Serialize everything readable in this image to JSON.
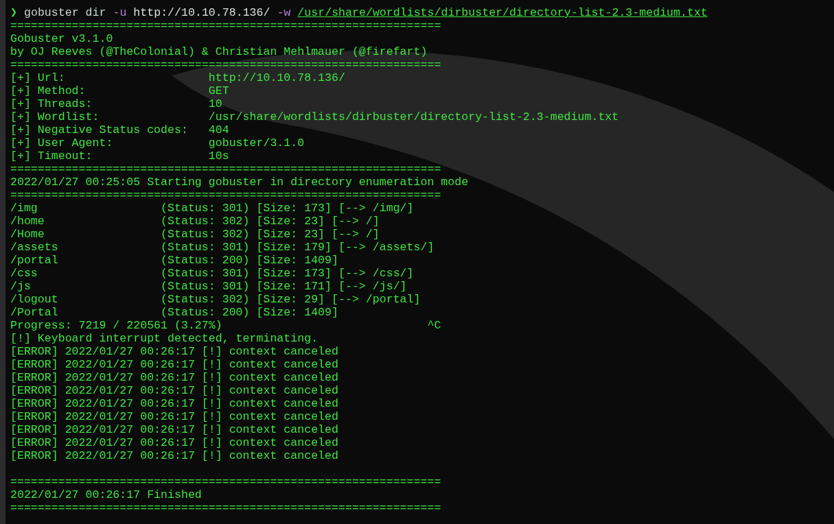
{
  "command_line": {
    "prompt": "❯",
    "segments": [
      {
        "kind": "command",
        "text": "gobuster dir"
      },
      {
        "kind": "flag",
        "text": "-u"
      },
      {
        "kind": "arg",
        "text": "http://10.10.78.136/"
      },
      {
        "kind": "flag",
        "text": "-w"
      },
      {
        "kind": "path",
        "text": "/usr/share/wordlists/dirbuster/directory-list-2.3-medium.txt"
      }
    ]
  },
  "output_lines": [
    {
      "kind": "rule",
      "text": "==============================================================="
    },
    {
      "kind": "text",
      "text": "Gobuster v3.1.0"
    },
    {
      "kind": "text",
      "text": "by OJ Reeves (@TheColonial) & Christian Mehlmauer (@firefart)"
    },
    {
      "kind": "rule",
      "text": "==============================================================="
    },
    {
      "kind": "text",
      "text": "[+] Url:                     http://10.10.78.136/"
    },
    {
      "kind": "text",
      "text": "[+] Method:                  GET"
    },
    {
      "kind": "text",
      "text": "[+] Threads:                 10"
    },
    {
      "kind": "text",
      "text": "[+] Wordlist:                /usr/share/wordlists/dirbuster/directory-list-2.3-medium.txt"
    },
    {
      "kind": "text",
      "text": "[+] Negative Status codes:   404"
    },
    {
      "kind": "text",
      "text": "[+] User Agent:              gobuster/3.1.0"
    },
    {
      "kind": "text",
      "text": "[+] Timeout:                 10s"
    },
    {
      "kind": "rule",
      "text": "==============================================================="
    },
    {
      "kind": "text",
      "text": "2022/01/27 00:25:05 Starting gobuster in directory enumeration mode"
    },
    {
      "kind": "rule",
      "text": "==============================================================="
    },
    {
      "kind": "text",
      "text": "/img                  (Status: 301) [Size: 173] [--> /img/]"
    },
    {
      "kind": "text",
      "text": "/home                 (Status: 302) [Size: 23] [--> /]"
    },
    {
      "kind": "text",
      "text": "/Home                 (Status: 302) [Size: 23] [--> /]"
    },
    {
      "kind": "text",
      "text": "/assets               (Status: 301) [Size: 179] [--> /assets/]"
    },
    {
      "kind": "text",
      "text": "/portal               (Status: 200) [Size: 1409]"
    },
    {
      "kind": "text",
      "text": "/css                  (Status: 301) [Size: 173] [--> /css/]"
    },
    {
      "kind": "text",
      "text": "/js                   (Status: 301) [Size: 171] [--> /js/]"
    },
    {
      "kind": "text",
      "text": "/logout               (Status: 302) [Size: 29] [--> /portal]"
    },
    {
      "kind": "text",
      "text": "/Portal               (Status: 200) [Size: 1409]"
    },
    {
      "kind": "text",
      "text": "Progress: 7219 / 220561 (3.27%)                              ^C"
    },
    {
      "kind": "text",
      "text": "[!] Keyboard interrupt detected, terminating."
    },
    {
      "kind": "text",
      "text": "[ERROR] 2022/01/27 00:26:17 [!] context canceled"
    },
    {
      "kind": "text",
      "text": "[ERROR] 2022/01/27 00:26:17 [!] context canceled"
    },
    {
      "kind": "text",
      "text": "[ERROR] 2022/01/27 00:26:17 [!] context canceled"
    },
    {
      "kind": "text",
      "text": "[ERROR] 2022/01/27 00:26:17 [!] context canceled"
    },
    {
      "kind": "text",
      "text": "[ERROR] 2022/01/27 00:26:17 [!] context canceled"
    },
    {
      "kind": "text",
      "text": "[ERROR] 2022/01/27 00:26:17 [!] context canceled"
    },
    {
      "kind": "text",
      "text": "[ERROR] 2022/01/27 00:26:17 [!] context canceled"
    },
    {
      "kind": "text",
      "text": "[ERROR] 2022/01/27 00:26:17 [!] context canceled"
    },
    {
      "kind": "text",
      "text": "[ERROR] 2022/01/27 00:26:17 [!] context canceled"
    },
    {
      "kind": "blank"
    },
    {
      "kind": "rule",
      "text": "==============================================================="
    },
    {
      "kind": "text",
      "text": "2022/01/27 00:26:17 Finished"
    },
    {
      "kind": "rule",
      "text": "==============================================================="
    }
  ]
}
